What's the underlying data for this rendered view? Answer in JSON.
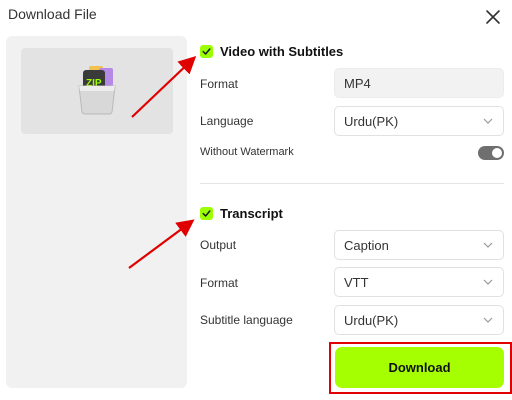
{
  "dialog": {
    "title": "Download File",
    "close_icon": "close-icon"
  },
  "thumbnail": {
    "icon": "zip-archive-icon",
    "badge_text": "ZIP"
  },
  "video_section": {
    "checked": true,
    "title": "Video with Subtitles",
    "format_label": "Format",
    "format_value": "MP4",
    "language_label": "Language",
    "language_value": "Urdu(PK)",
    "watermark_label": "Without Watermark",
    "watermark_enabled": true
  },
  "transcript_section": {
    "checked": true,
    "title": "Transcript",
    "output_label": "Output",
    "output_value": "Caption",
    "format_label": "Format",
    "format_value": "VTT",
    "subtitle_language_label": "Subtitle language",
    "subtitle_language_value": "Urdu(PK)"
  },
  "actions": {
    "download_label": "Download"
  },
  "colors": {
    "accent": "#a6ff00",
    "annotation": "#e00000",
    "toggle_on": "#6f6f6f"
  }
}
